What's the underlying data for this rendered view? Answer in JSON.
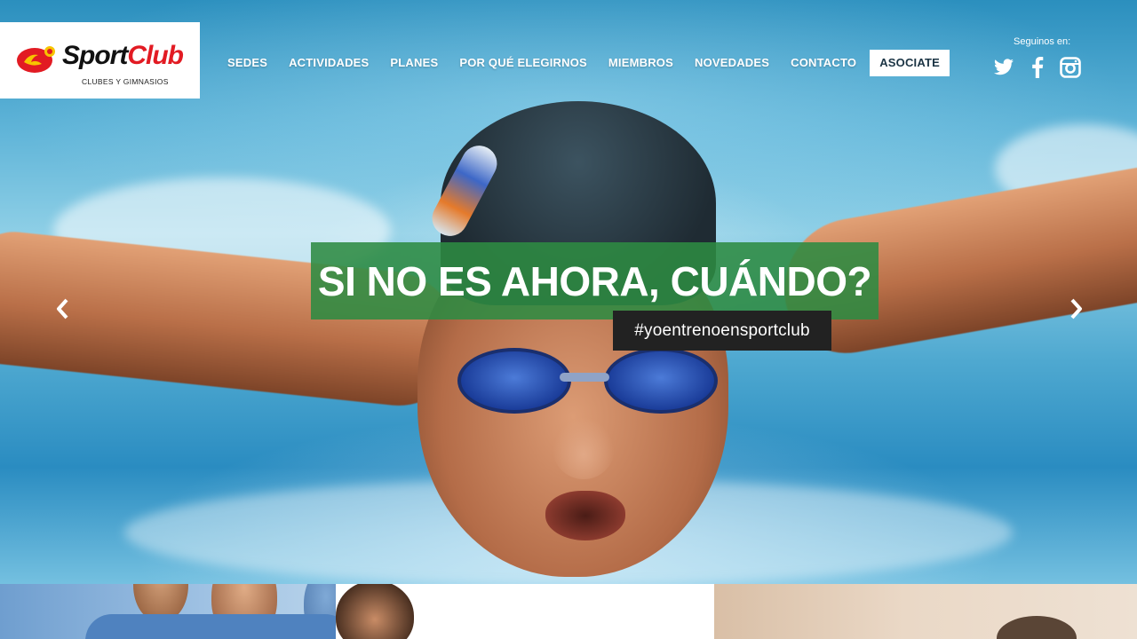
{
  "brand": {
    "name_part1": "Sport",
    "name_part2": "Club",
    "tagline": "CLUBES Y GIMNASIOS",
    "colors": {
      "red": "#e21b23",
      "yellow": "#f7c400",
      "dark": "#111111"
    }
  },
  "nav": {
    "items": [
      {
        "label": "SEDES"
      },
      {
        "label": "ACTIVIDADES"
      },
      {
        "label": "PLANES"
      },
      {
        "label": "POR QUÉ ELEGIRNOS"
      },
      {
        "label": "MIEMBROS"
      },
      {
        "label": "NOVEDADES"
      },
      {
        "label": "CONTACTO"
      }
    ],
    "cta_label": "ASOCIATE"
  },
  "social": {
    "label": "Seguinos en:",
    "icons": [
      "twitter-icon",
      "facebook-icon",
      "instagram-icon"
    ]
  },
  "hero": {
    "headline": "SI NO ES AHORA, CUÁNDO?",
    "hashtag": "#yoentrenoensportclub",
    "headline_bg": "#2e8b42",
    "hashtag_bg": "#222222",
    "arrows": [
      "chevron-left-icon",
      "chevron-right-icon"
    ]
  }
}
